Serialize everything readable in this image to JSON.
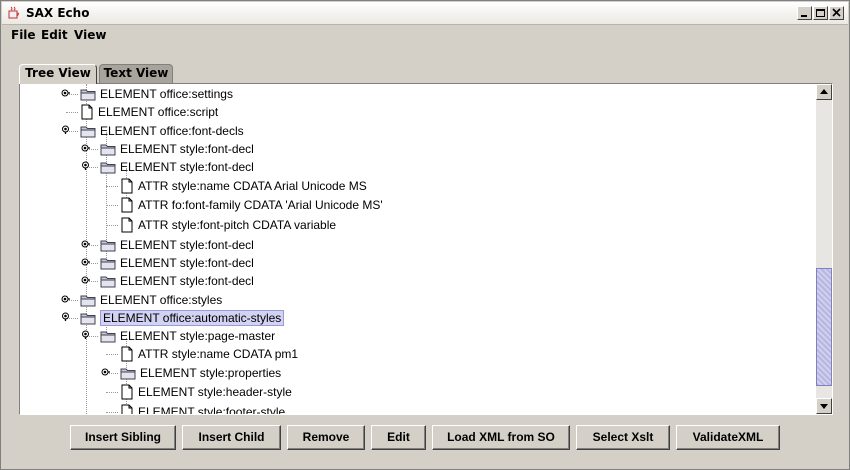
{
  "window": {
    "title": "SAX Echo"
  },
  "menu": [
    "File",
    "Edit",
    "View"
  ],
  "tabs": [
    {
      "label": "Tree View",
      "active": true
    },
    {
      "label": "Text View",
      "active": false
    }
  ],
  "tree": {
    "nodes": [
      {
        "label": "ELEMENT office:settings",
        "type": "folder",
        "state": "collapsed"
      },
      {
        "label": "ELEMENT office:script",
        "type": "file"
      },
      {
        "label": "ELEMENT office:font-decls",
        "type": "folder",
        "state": "expanded"
      },
      {
        "label": "ELEMENT style:font-decl",
        "type": "folder",
        "state": "collapsed"
      },
      {
        "label": "ELEMENT style:font-decl",
        "type": "folder",
        "state": "expanded"
      },
      {
        "label": "ATTR style:name CDATA Arial Unicode MS",
        "type": "file"
      },
      {
        "label": "ATTR fo:font-family CDATA 'Arial Unicode MS'",
        "type": "file"
      },
      {
        "label": "ATTR style:font-pitch CDATA variable",
        "type": "file"
      },
      {
        "label": "ELEMENT style:font-decl",
        "type": "folder",
        "state": "collapsed"
      },
      {
        "label": "ELEMENT style:font-decl",
        "type": "folder",
        "state": "collapsed"
      },
      {
        "label": "ELEMENT style:font-decl",
        "type": "folder",
        "state": "collapsed"
      },
      {
        "label": "ELEMENT office:styles",
        "type": "folder",
        "state": "collapsed"
      },
      {
        "label": "ELEMENT office:automatic-styles",
        "type": "folder",
        "state": "expanded",
        "selected": true
      },
      {
        "label": "ELEMENT style:page-master",
        "type": "folder",
        "state": "expanded"
      },
      {
        "label": "ATTR style:name CDATA pm1",
        "type": "file"
      },
      {
        "label": "ELEMENT style:properties",
        "type": "folder",
        "state": "collapsed"
      },
      {
        "label": "ELEMENT style:header-style",
        "type": "file"
      },
      {
        "label": "ELEMENT style:footer-style",
        "type": "file"
      }
    ]
  },
  "buttons": [
    "Insert Sibling",
    "Insert Child",
    "Remove",
    "Edit",
    "Load XML from SO",
    "Select Xslt",
    "ValidateXML"
  ]
}
